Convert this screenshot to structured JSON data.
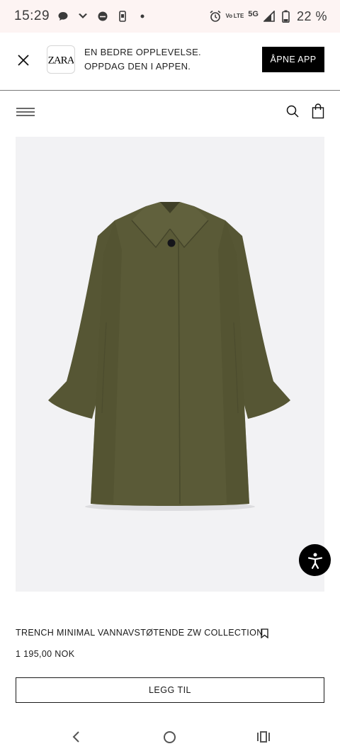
{
  "status_bar": {
    "time": "15:29",
    "volte": "Vo LTE",
    "network": "5G",
    "battery_text": "22 %",
    "icons": [
      "chat-bubble-icon",
      "chevron-down-icon",
      "messenger-icon",
      "phone-icon",
      "dot-icon",
      "alarm-icon",
      "signal-icon",
      "battery-icon"
    ]
  },
  "banner": {
    "logo_text": "ZARA",
    "line1": "EN BEDRE OPPLEVELSE.",
    "line2": "OPPDAG DEN I APPEN.",
    "open_app_label": "ÅPNE APP"
  },
  "product": {
    "name": "TRENCH MINIMAL VANNAVSTØTENDE ZW COLLECTION",
    "price": "1 195,00 NOK",
    "add_label": "LEGG TIL",
    "image_colors": {
      "background": "#f2f2f4",
      "coat": "#5a5a37"
    }
  },
  "colors": {
    "status_bar_bg": "#fdf4f3",
    "button_black": "#000000"
  }
}
